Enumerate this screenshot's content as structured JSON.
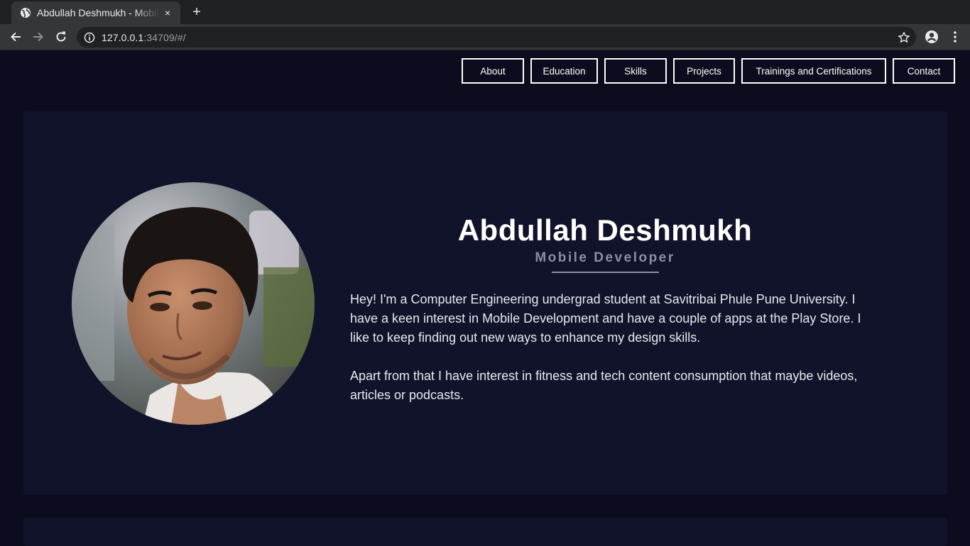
{
  "browser": {
    "tab_title": "Abdullah Deshmukh - Mobile Developer",
    "tab_close": "×",
    "new_tab": "+",
    "url_host": "127.0.0.1",
    "url_rest": ":34709/#/"
  },
  "nav": {
    "items": [
      "About",
      "Education",
      "Skills",
      "Projects",
      "Trainings and Certifications",
      "Contact"
    ]
  },
  "hero": {
    "name": "Abdullah Deshmukh",
    "role": "Mobile Developer",
    "bio": [
      "Hey! I'm a Computer Engineering undergrad student at Savitribai Phule Pune University. I have a keen interest in Mobile Development and have a couple of apps at the Play Store. I like to keep finding out new ways to enhance my design skills.",
      "Apart from that I have interest in fitness and tech content consumption that maybe videos, articles or podcasts."
    ]
  },
  "colors": {
    "page_bg": "#0b0d1e",
    "card_bg": "#11132b",
    "accent_muted": "#8a8fa3"
  }
}
